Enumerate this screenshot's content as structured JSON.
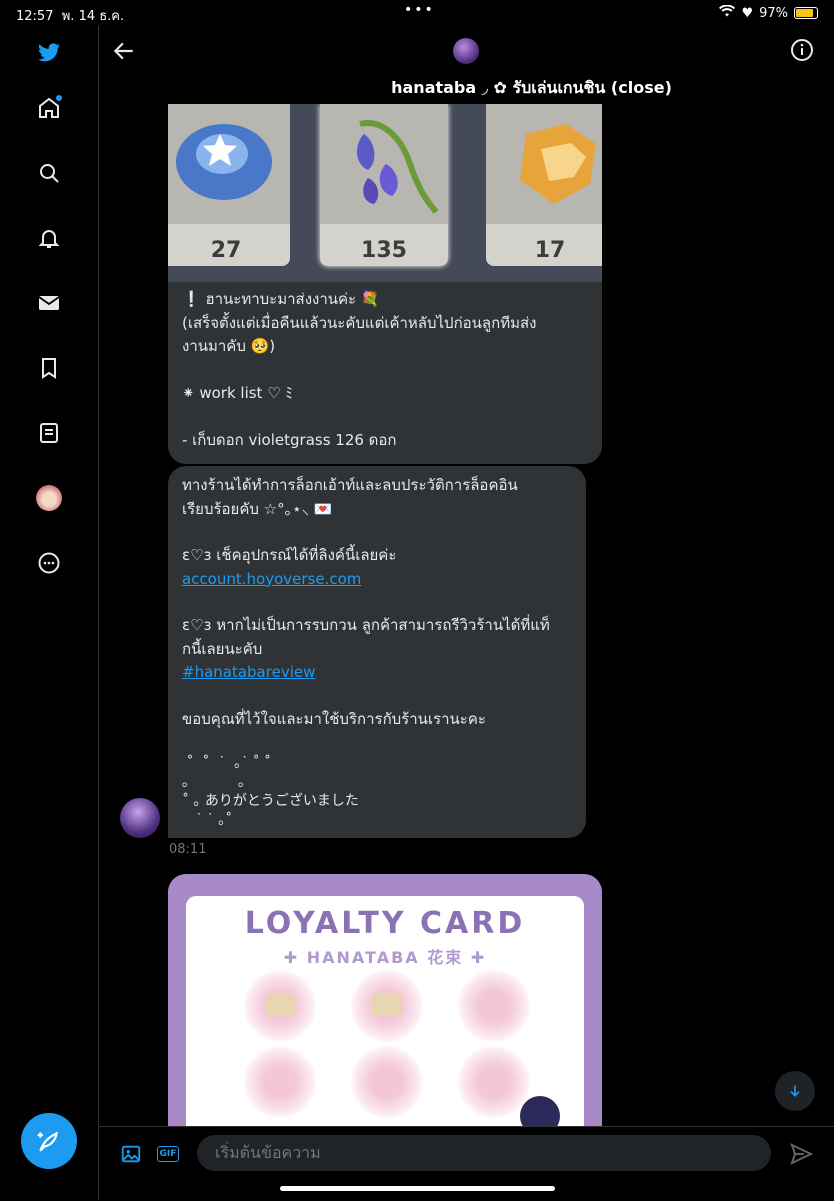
{
  "status": {
    "time": "12:57",
    "date": "พ. 14 ธ.ค.",
    "dots": "•••",
    "battery": "97%"
  },
  "header": {
    "title": "hanataba ◞ ✿ รับเล่นเกนชิน (close)"
  },
  "message1": {
    "tiles": [
      "27",
      "135",
      "17"
    ],
    "text": "❕ ฮานะทาบะมาส่งงานค่ะ 💐\n(เสร็จตั้งแต่เมื่อคืนแล้วนะคับแต่เค้าหลับไปก่อนลูกทีมส่ง\nงานมาคับ 🥺)\n\n⁕ work list ♡ ﾐ\n\n- เก็บดอก violetgrass 126 ดอก"
  },
  "message2": {
    "line1": "ทางร้านได้ทำการล็อกเอ้าท์และลบประวัติการล็อคอิน\nเรียบร้อยคับ ☆°｡⋆⸜ 💌",
    "line2": "ɛ♡з เช็คอุปกรณ์ได้ที่ลิงค์นี้เลยค่ะ",
    "link": "account.hoyoverse.com",
    "line3": "ɛ♡з หากไม่เป็นการรบกวน ลูกค้าสามารถรีวิวร้านได้ที่แท็\nกนี้เลยนะคับ",
    "hashtag": "#hanatabareview",
    "line4": "ขอบคุณที่ไว้ใจและมาใช้บริการกับร้านเรานะคะ",
    "line5": " ˚  ˚  ˙  ｡˙ ˚ ˚\n｡           ｡\n˚ ｡ ありがとうございました\n   ˙ ˙ ｡˚",
    "time": "08:11"
  },
  "card": {
    "title": "LOYALTY CARD",
    "subtitle": "✚ HANATABA 花束 ✚"
  },
  "compose": {
    "placeholder": "เริ่มต้นข้อความ",
    "gif": "GIF"
  }
}
